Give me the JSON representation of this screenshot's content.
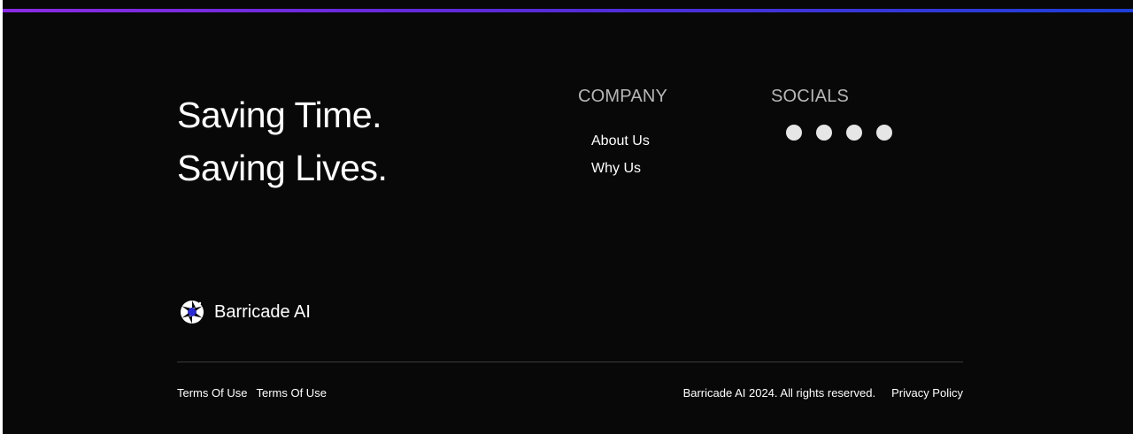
{
  "colors": {
    "background": "#080808",
    "accent_gradient_start": "#8a2be2",
    "accent_gradient_end": "#1e3fd8",
    "text": "#ffffff",
    "heading": "#b7b7b7",
    "social_dot": "#e6e6e6"
  },
  "tagline": {
    "line1": "Saving Time.",
    "line2": "Saving Lives."
  },
  "company": {
    "heading": "COMPANY",
    "links": [
      "About Us",
      "Why Us"
    ]
  },
  "socials": {
    "heading": "SOCIALS",
    "icons": [
      "social-icon",
      "social-icon",
      "social-icon",
      "social-icon"
    ]
  },
  "brand": {
    "name": "Barricade AI",
    "logo_icon": "aperture-logo-icon"
  },
  "bottom": {
    "left_links": [
      "Terms Of Use",
      "Terms Of Use"
    ],
    "copyright": "Barricade AI 2024. All rights reserved.",
    "privacy_policy": "Privacy Policy"
  }
}
